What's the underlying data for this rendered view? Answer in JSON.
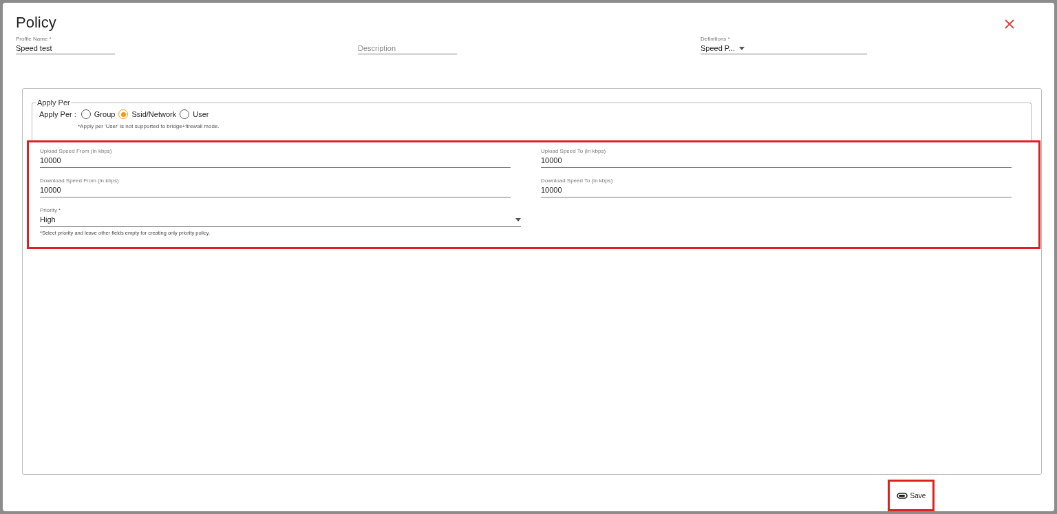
{
  "dialog": {
    "title": "Policy"
  },
  "header_fields": [
    {
      "kind": "text",
      "label": "Profile Name *",
      "value": "Speed test"
    },
    {
      "kind": "placeholder",
      "placeholder": "Description"
    },
    {
      "kind": "select",
      "label": "Definitions *",
      "value": "Speed P..."
    }
  ],
  "apply_per": {
    "legend": "Apply Per",
    "label": "Apply Per :",
    "options": [
      {
        "label": "Group",
        "selected": false
      },
      {
        "label": "Ssid/Network",
        "selected": true
      },
      {
        "label": "User",
        "selected": false
      }
    ],
    "note": "*Apply per 'User' is not supported to bridge+firewall mode."
  },
  "speed_section": {
    "highlighted": true,
    "fields": [
      {
        "label": "Upload Speed From (in kbps)",
        "value": "10000"
      },
      {
        "label": "Upload Speed To (in kbps)",
        "value": "10000"
      },
      {
        "label": "Download Speed From (in kbps)",
        "value": "10000"
      },
      {
        "label": "Download Speed To (in kbps)",
        "value": "10000"
      }
    ],
    "priority": {
      "label": "Priority *",
      "value": "High",
      "note": "*Select priority and leave other fields empty for creating only priority policy."
    }
  },
  "save_button": {
    "label": "Save",
    "highlighted": true
  }
}
